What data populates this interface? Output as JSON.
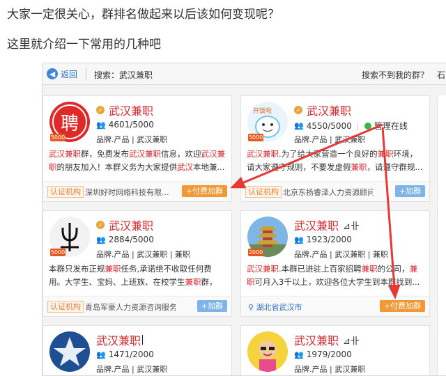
{
  "intro": {
    "line1": "大家一定很关心，群排名做起来以后该如何变现呢？",
    "line2": "这里就介绍一下常用的几种吧"
  },
  "topbar": {
    "back_label": "返回",
    "search_text": "搜索：武汉兼职",
    "not_found": "搜索不到我的群？",
    "more": "石"
  },
  "cards": [
    {
      "name": "武汉兼职",
      "extra": "",
      "count": "4601/5000",
      "online": "",
      "tags": "品牌.产品 | 武汉兼职",
      "avatar_badge": "5000",
      "avatar_text": "聘",
      "desc_parts": [
        "武汉兼职",
        "群，免费发布",
        "武汉兼职",
        "信息，欢迎",
        "武汉兼职",
        "的朋友加入！本群义务为大家提供",
        "武汉",
        "本地兼..."
      ],
      "cert": "认证机构",
      "company": "深圳好时网络科技有限...",
      "location": "",
      "join": "+付费加群",
      "join_style": "orange"
    },
    {
      "name": "武汉兼职",
      "extra": "",
      "count": "4550/5000",
      "online": "管理在线",
      "tags": "品牌.产品 | 武汉兼职",
      "avatar_badge": "5000",
      "avatar_text": "开饭啦",
      "desc_parts": [
        "武汉兼职",
        ".为了给大家营造一个良好的",
        "兼职",
        "环境，请大家遵守规则，不要发虚假",
        "兼职",
        "，请遵守群规..."
      ],
      "cert": "认证机构",
      "company": "北京东扬睿泽人力资源顾问...",
      "location": "",
      "join": "+加群",
      "join_style": "blue"
    },
    {
      "name": "武汉兼职",
      "extra": "",
      "count": "2884/5000",
      "online": "",
      "tags": "品牌.产品 | 武汉兼职 | 兼职",
      "avatar_badge": "5000",
      "avatar_text": "",
      "desc_parts": [
        "本群只发布正规",
        "兼职",
        "任务,承诺绝不收取任何费用。大学生、宝妈、上班族、在校学生",
        "兼职",
        "群，最..."
      ],
      "cert": "认证机构",
      "company": "青岛军豪人力资源咨询服务...",
      "location": "",
      "join": "+加群",
      "join_style": "blue"
    },
    {
      "name": "武汉兼职",
      "extra": "⊿卝",
      "count": "1923/2000",
      "online": "",
      "tags": "品牌.产品 | 武汉兼职 | 兼职",
      "avatar_badge": "2000",
      "avatar_text": "",
      "desc_parts": [
        "武汉兼职",
        ".本群已进驻上百家招聘",
        "兼职",
        "的公司，",
        "兼职",
        "可月入3千以上，欢迎各位大学生到本群找到..."
      ],
      "cert": "",
      "company": "",
      "location": "湖北省武汉市",
      "join": "+付费加群",
      "join_style": "orange"
    },
    {
      "name": "武汉兼职",
      "extra": "",
      "count": "1471/2000",
      "online": "",
      "tags": "品牌.产品 | 武汉兼职",
      "avatar_badge": "",
      "avatar_text": ""
    },
    {
      "name": "武汉兼职",
      "extra": "⊿卝",
      "count": "1979/2000",
      "online": "",
      "tags": "品牌.产品 | 武汉兼职",
      "avatar_badge": "",
      "avatar_text": ""
    }
  ],
  "colors": {
    "accent_red": "#d8232a",
    "join_orange": "#f29836",
    "join_blue": "#7db5e8",
    "arrow_red": "#e53935"
  }
}
